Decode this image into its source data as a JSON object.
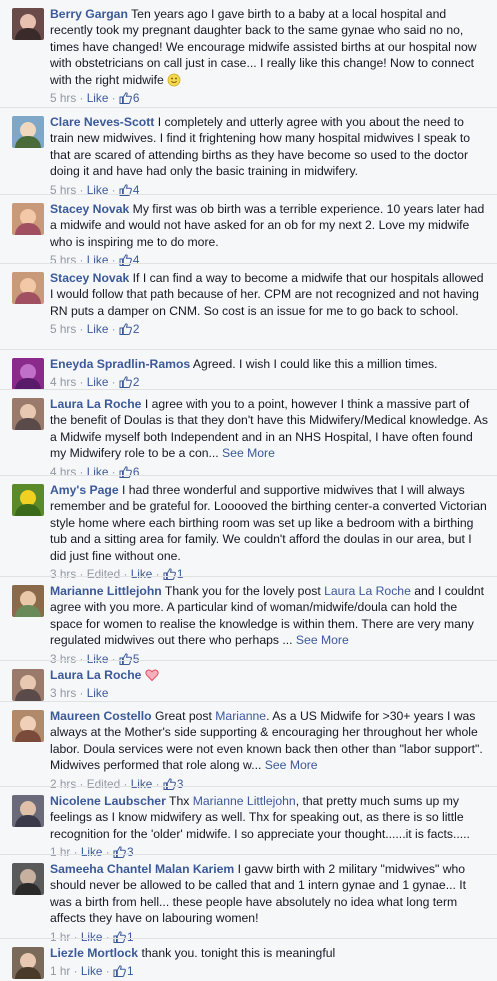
{
  "comments": [
    {
      "author": "Berry Gargan",
      "text": "Ten years ago I gave birth to a baby at a local hospital and recently took my pregnant daughter back to the same gynae who said no no, times have changed! We encourage midwife assisted births at our hospital now with obstetricians on call just in case... I really like this change! Now to connect with the right midwife",
      "time": "5 hrs",
      "like_label": "Like",
      "likes": "6"
    },
    {
      "author": "Clare Neves-Scott",
      "text": "I completely and utterly agree with you about the need to train new midwives. I find it frightening how many hospital midwives I speak to that are scared of attending births as they have become so used to the doctor doing it and have had only the basic training in midwifery.",
      "time": "5 hrs",
      "like_label": "Like",
      "likes": "4"
    },
    {
      "author": "Stacey Novak",
      "text": "My first was ob birth was a terrible experience. 10 years later had a midwife and would not have asked for an ob for my next 2. Love my midwife who is inspiring me to do more.",
      "time": "5 hrs",
      "like_label": "Like",
      "likes": "4"
    },
    {
      "author": "Stacey Novak",
      "text": "If I can find a way to become a midwife that our hospitals allowed I would follow that path because of her. CPM are not recognized and not having RN puts a damper on CNM. So cost is an issue for me to go back to school.",
      "time": "5 hrs",
      "like_label": "Like",
      "likes": "2"
    },
    {
      "author": "Eneyda Spradlin-Ramos",
      "text": "Agreed. I wish I could like this a million times.",
      "time": "4 hrs",
      "like_label": "Like",
      "likes": "2"
    },
    {
      "author": "Laura La Roche",
      "text": "I agree with you to a point, however I think a massive part of the benefit of Doulas is that they don't have this Midwifery/Medical knowledge. As a Midwife myself both Independent and in an NHS Hospital, I have often found my Midwifery role to be a con...",
      "see_more": "See More",
      "time": "4 hrs",
      "like_label": "Like",
      "likes": "6"
    },
    {
      "author": "Amy's Page",
      "text": "I had three wonderful and supportive midwives that I will always remember and be grateful for. Looooved the birthing center-a converted Victorian style home where each birthing room was set up like a bedroom with a birthing tub and a sitting area for family. We couldn't afford the doulas in our area, but I did just fine without one.",
      "time": "3 hrs",
      "edited": "Edited",
      "like_label": "Like",
      "likes": "1"
    },
    {
      "author": "Marianne Littlejohn",
      "text_before": "Thank you for the lovely post",
      "mention": "Laura La Roche",
      "text_after": "and I couldnt agree with you more. A particular kind of woman/midwife/doula can hold the space for women to realise the knowledge is within them. There are very many regulated midwives out there who perhaps ...",
      "see_more": "See More",
      "time": "3 hrs",
      "like_label": "Like",
      "likes": "5"
    },
    {
      "author": "Laura La Roche",
      "time": "3 hrs",
      "like_label": "Like"
    },
    {
      "author": "Maureen Costello",
      "text_before": "Great post",
      "mention": "Marianne",
      "text_after": ". As a US Midwife for >30+ years I was always at the Mother's side supporting & encouraging her throughout her whole labor. Doula services were not even known back then other than \"labor support\". Midwives performed that role along w...",
      "see_more": "See More",
      "time": "2 hrs",
      "edited": "Edited",
      "like_label": "Like",
      "likes": "3"
    },
    {
      "author": "Nicolene Laubscher",
      "text_before": "Thx",
      "mention": "Marianne Littlejohn",
      "text_after": ", that pretty much sums up my feelings as I know midwifery as well. Thx for speaking out, as there is so little recognition for the 'older' midwife. I so appreciate your thought......it is facts.....",
      "time": "1 hr",
      "like_label": "Like",
      "likes": "3"
    },
    {
      "author": "Sameeha Chantel Malan Kariem",
      "text": "I gavw birth with 2 military \"midwives\" who should never be allowed to be called that and 1 intern gynae and 1 gynae... It was a birth from hell... these people have absolutely no idea what long term affects they have on labouring women!",
      "time": "1 hr",
      "like_label": "Like",
      "likes": "1"
    },
    {
      "author": "Liezle Mortlock",
      "text": "thank you. tonight this is meaningful",
      "time": "1 hr",
      "like_label": "Like",
      "likes": "1"
    }
  ],
  "separator": "·",
  "colors": {
    "link": "#3b5998",
    "meta": "#9197a3",
    "background": "#f6f7f9"
  },
  "icons": {
    "like_count": "thumbs-up-icon",
    "smiley": "smiley-emoji-icon",
    "heart": "heart-emoji-icon"
  }
}
